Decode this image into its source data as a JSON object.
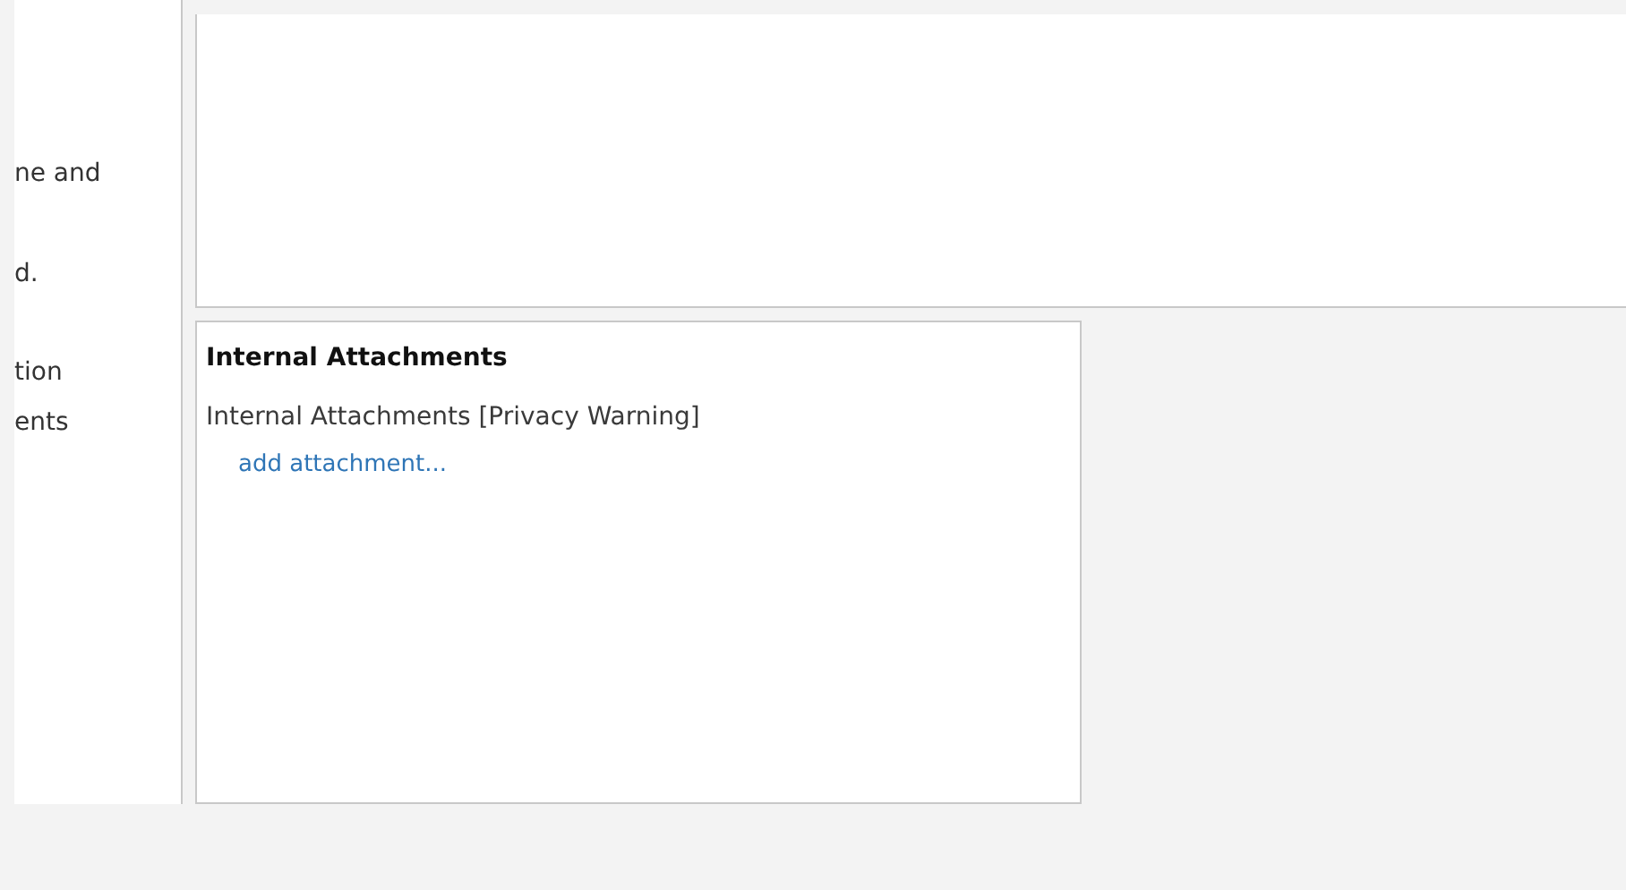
{
  "left_panel": {
    "lines": [
      "ne and",
      "d.",
      "tion",
      "ents"
    ]
  },
  "attachments_panel": {
    "title": "Internal Attachments",
    "label": "Internal Attachments [Privacy Warning]",
    "link": "add attachment..."
  }
}
